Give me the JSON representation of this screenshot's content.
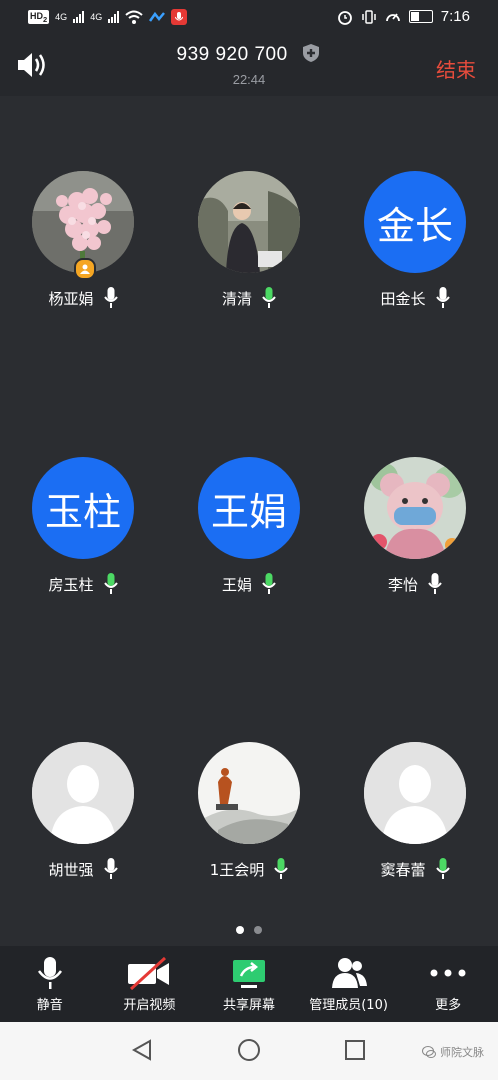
{
  "status_bar": {
    "left_badge": "HD",
    "left_badge_sub": "2",
    "sig1": "4G",
    "sig2": "4G",
    "time": "7:16"
  },
  "header": {
    "meeting_id": "939 920 700",
    "duration": "22:44",
    "end_label": "结束"
  },
  "participants": [
    {
      "name": "杨亚娟",
      "avatar_type": "photo-flower",
      "host": true,
      "mic_color": "#ffffff"
    },
    {
      "name": "清清",
      "avatar_type": "photo-person",
      "host": false,
      "mic_color": "#4cd964"
    },
    {
      "name": "田金长",
      "avatar_type": "text",
      "avatar_text": "金长",
      "host": false,
      "mic_color": "#ffffff"
    },
    {
      "name": "房玉柱",
      "avatar_type": "text",
      "avatar_text": "玉柱",
      "host": false,
      "mic_color": "#4cd964"
    },
    {
      "name": "王娟",
      "avatar_type": "text",
      "avatar_text": "王娟",
      "host": false,
      "mic_color": "#4cd964"
    },
    {
      "name": "李怡",
      "avatar_type": "photo-toy",
      "host": false,
      "mic_color": "#ffffff"
    },
    {
      "name": "胡世强",
      "avatar_type": "default",
      "host": false,
      "mic_color": "#ffffff"
    },
    {
      "name": "1王会明",
      "avatar_type": "photo-landscape",
      "host": false,
      "mic_color": "#4cd964"
    },
    {
      "name": "窦春蕾",
      "avatar_type": "default",
      "host": false,
      "mic_color": "#4cd964"
    }
  ],
  "toolbar": {
    "mute": "静音",
    "video": "开启视频",
    "share": "共享屏幕",
    "members": "管理成员(10)",
    "more": "更多"
  },
  "page_indicator": {
    "current": 1,
    "total": 2
  },
  "watermark": "师院文脉",
  "colors": {
    "accent": "#1b6ef3",
    "end": "#e74c3c",
    "mic_active": "#4cd964",
    "share": "#2ecc71"
  }
}
